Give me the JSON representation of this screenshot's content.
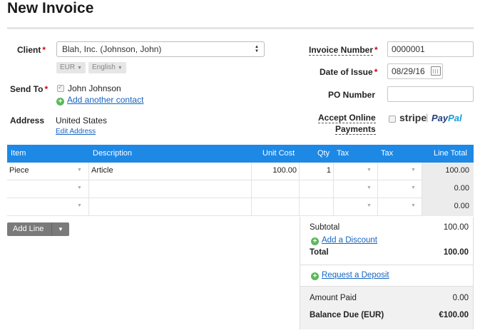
{
  "title": "New Invoice",
  "client": {
    "label": "Client",
    "value": "Blah, Inc. (Johnson, John)",
    "currency": "EUR",
    "language": "English"
  },
  "send_to": {
    "label": "Send To",
    "contact": "John Johnson",
    "add_contact": "Add another contact"
  },
  "address": {
    "label": "Address",
    "value": "United States",
    "edit": "Edit Address"
  },
  "invoice_number": {
    "label": "Invoice Number",
    "value": "0000001"
  },
  "date_of_issue": {
    "label": "Date of Issue",
    "value": "08/29/16"
  },
  "po_number": {
    "label": "PO Number",
    "value": ""
  },
  "online_payments": {
    "label_line1": "Accept Online",
    "label_line2": "Payments",
    "stripe": "stripe",
    "paypal_a": "Pay",
    "paypal_b": "Pal"
  },
  "table": {
    "headers": {
      "item": "Item",
      "description": "Description",
      "unit_cost": "Unit Cost",
      "qty": "Qty",
      "tax1": "Tax",
      "tax2": "Tax",
      "line_total": "Line Total"
    },
    "rows": [
      {
        "item": "Piece",
        "description": "Article",
        "unit_cost": "100.00",
        "qty": "1",
        "line_total": "100.00"
      },
      {
        "item": "",
        "description": "",
        "unit_cost": "",
        "qty": "",
        "line_total": "0.00"
      },
      {
        "item": "",
        "description": "",
        "unit_cost": "",
        "qty": "",
        "line_total": "0.00"
      }
    ]
  },
  "add_line": "Add Line",
  "totals": {
    "subtotal_label": "Subtotal",
    "subtotal_value": "100.00",
    "add_discount": "Add a Discount",
    "total_label": "Total",
    "total_value": "100.00",
    "request_deposit": "Request a Deposit",
    "amount_paid_label": "Amount Paid",
    "amount_paid_value": "0.00",
    "balance_label": "Balance Due (EUR)",
    "balance_value": "€100.00"
  },
  "colors": {
    "header_blue": "#1e88e5",
    "required_red": "#d0021b",
    "link_blue": "#1565c0",
    "plus_green": "#5cb85c"
  }
}
